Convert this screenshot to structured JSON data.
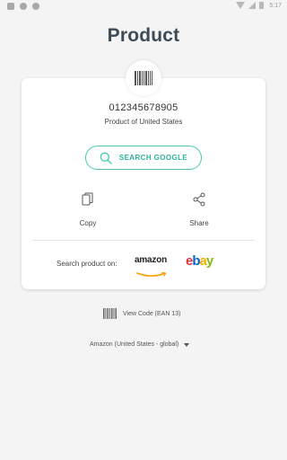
{
  "status_bar": {
    "time": "5:17",
    "left_icons": [
      "notification-icon",
      "sync-icon",
      "circle-icon"
    ],
    "right_icons": [
      "wifi-icon",
      "signal-icon",
      "battery-icon"
    ]
  },
  "page": {
    "title": "Product"
  },
  "product": {
    "code": "012345678905",
    "origin": "Product of United States"
  },
  "actions": {
    "search_google": "SEARCH GOOGLE",
    "copy": "Copy",
    "share": "Share"
  },
  "search_product": {
    "label": "Search product on:",
    "stores": [
      {
        "name": "amazon",
        "icon": "amazon-logo"
      },
      {
        "name": "ebay",
        "icon": "ebay-logo"
      }
    ]
  },
  "view_code": {
    "label": "View Code (EAN 13)"
  },
  "store_region": {
    "selected": "Amazon (United States - global)"
  },
  "colors": {
    "accent": "#48c9b0",
    "title": "#3c4b57",
    "ebay_red": "#e53238",
    "ebay_blue": "#0064d2",
    "ebay_yellow": "#f5af02",
    "ebay_green": "#86b817",
    "amazon_orange": "#ff9900"
  }
}
